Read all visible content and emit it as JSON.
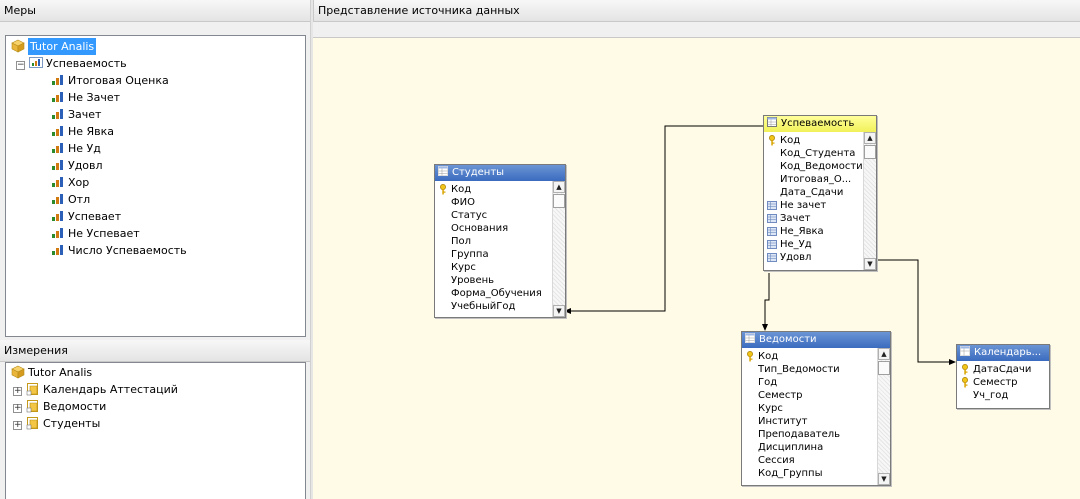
{
  "measures": {
    "header": "Меры",
    "root": "Tutor Analis",
    "group": "Успеваемость",
    "items": [
      "Итоговая Оценка",
      "Не Зачет",
      "Зачет",
      "Не Явка",
      "Не Уд",
      "Удовл",
      "Хор",
      "Отл",
      "Успевает",
      "Не Успевает",
      "Число Успеваемость"
    ]
  },
  "dimensions": {
    "header": "Измерения",
    "root": "Tutor Analis",
    "items": [
      "Календарь Аттестаций",
      "Ведомости",
      "Студенты"
    ]
  },
  "dsv": {
    "header": "Представление источника данных",
    "tables": {
      "students": {
        "title": "Студенты",
        "columns": [
          "Код",
          "ФИО",
          "Статус",
          "Основания",
          "Пол",
          "Группа",
          "Курс",
          "Уровень",
          "Форма_Обучения",
          "УчебныйГод"
        ]
      },
      "progress": {
        "title": "Успеваемость",
        "columns": [
          "Код",
          "Код_Студента",
          "Код_Ведомости",
          "Итоговая_О...",
          "Дата_Сдачи",
          "Не зачет",
          "Зачет",
          "Не_Явка",
          "Не_Уд",
          "Удовл"
        ]
      },
      "statements": {
        "title": "Ведомости",
        "columns": [
          "Код",
          "Тип_Ведомости",
          "Год",
          "Семестр",
          "Курс",
          "Институт",
          "Преподаватель",
          "Дисциплина",
          "Сессия",
          "Код_Группы"
        ]
      },
      "calendar": {
        "title": "Календарь...",
        "columns": [
          "ДатаСдачи",
          "Семестр",
          "Уч_год"
        ]
      }
    }
  },
  "icons": {
    "cube": "cube-icon",
    "measure_group": "measure-group-icon",
    "measure": "measure-bars-icon",
    "dimension": "dimension-icon",
    "table": "table-icon",
    "key": "key-icon",
    "measure_column": "calculated-column-icon"
  },
  "colors": {
    "selection": "#3399ff",
    "table_header": "#3a6bbf",
    "fact_header": "#f1f15a",
    "canvas": "#fffbe6"
  }
}
